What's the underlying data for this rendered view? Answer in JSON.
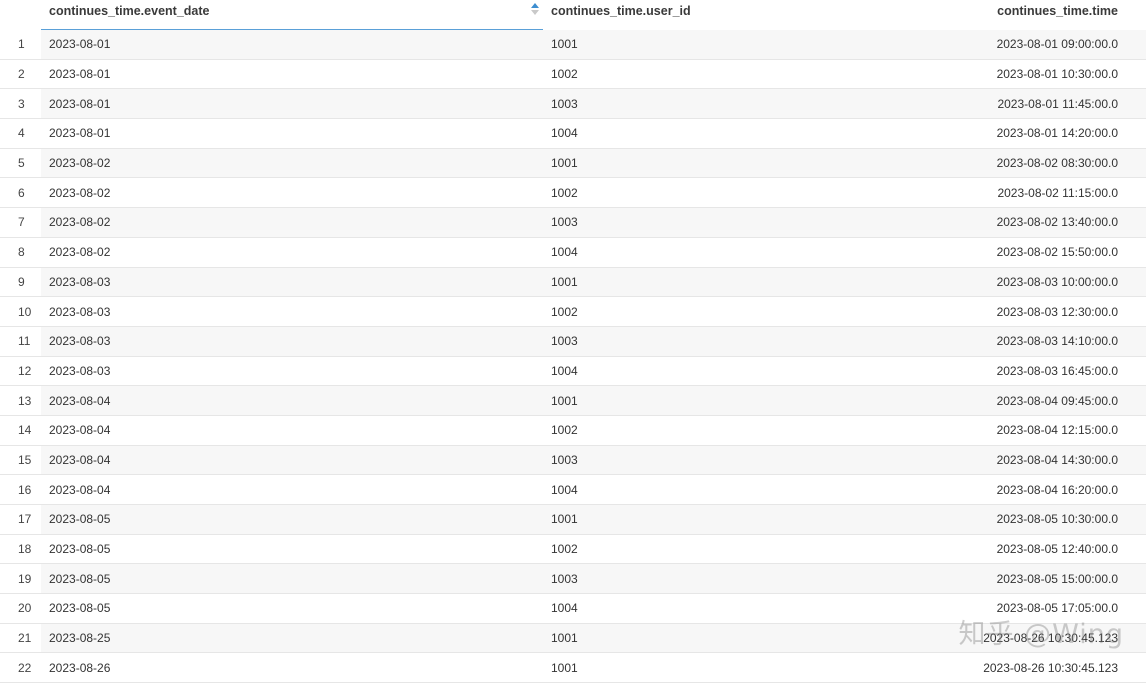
{
  "columns": [
    {
      "label": "continues_time.event_date",
      "sorted": "ascending"
    },
    {
      "label": "continues_time.user_id"
    },
    {
      "label": "continues_time.time"
    }
  ],
  "rows": [
    {
      "n": "1",
      "event_date": "2023-08-01",
      "user_id": "1001",
      "time": "2023-08-01 09:00:00.0"
    },
    {
      "n": "2",
      "event_date": "2023-08-01",
      "user_id": "1002",
      "time": "2023-08-01 10:30:00.0"
    },
    {
      "n": "3",
      "event_date": "2023-08-01",
      "user_id": "1003",
      "time": "2023-08-01 11:45:00.0"
    },
    {
      "n": "4",
      "event_date": "2023-08-01",
      "user_id": "1004",
      "time": "2023-08-01 14:20:00.0"
    },
    {
      "n": "5",
      "event_date": "2023-08-02",
      "user_id": "1001",
      "time": "2023-08-02 08:30:00.0"
    },
    {
      "n": "6",
      "event_date": "2023-08-02",
      "user_id": "1002",
      "time": "2023-08-02 11:15:00.0"
    },
    {
      "n": "7",
      "event_date": "2023-08-02",
      "user_id": "1003",
      "time": "2023-08-02 13:40:00.0"
    },
    {
      "n": "8",
      "event_date": "2023-08-02",
      "user_id": "1004",
      "time": "2023-08-02 15:50:00.0"
    },
    {
      "n": "9",
      "event_date": "2023-08-03",
      "user_id": "1001",
      "time": "2023-08-03 10:00:00.0"
    },
    {
      "n": "10",
      "event_date": "2023-08-03",
      "user_id": "1002",
      "time": "2023-08-03 12:30:00.0"
    },
    {
      "n": "11",
      "event_date": "2023-08-03",
      "user_id": "1003",
      "time": "2023-08-03 14:10:00.0"
    },
    {
      "n": "12",
      "event_date": "2023-08-03",
      "user_id": "1004",
      "time": "2023-08-03 16:45:00.0"
    },
    {
      "n": "13",
      "event_date": "2023-08-04",
      "user_id": "1001",
      "time": "2023-08-04 09:45:00.0"
    },
    {
      "n": "14",
      "event_date": "2023-08-04",
      "user_id": "1002",
      "time": "2023-08-04 12:15:00.0"
    },
    {
      "n": "15",
      "event_date": "2023-08-04",
      "user_id": "1003",
      "time": "2023-08-04 14:30:00.0"
    },
    {
      "n": "16",
      "event_date": "2023-08-04",
      "user_id": "1004",
      "time": "2023-08-04 16:20:00.0"
    },
    {
      "n": "17",
      "event_date": "2023-08-05",
      "user_id": "1001",
      "time": "2023-08-05 10:30:00.0"
    },
    {
      "n": "18",
      "event_date": "2023-08-05",
      "user_id": "1002",
      "time": "2023-08-05 12:40:00.0"
    },
    {
      "n": "19",
      "event_date": "2023-08-05",
      "user_id": "1003",
      "time": "2023-08-05 15:00:00.0"
    },
    {
      "n": "20",
      "event_date": "2023-08-05",
      "user_id": "1004",
      "time": "2023-08-05 17:05:00.0"
    },
    {
      "n": "21",
      "event_date": "2023-08-25",
      "user_id": "1001",
      "time": "2023-08-26 10:30:45.123"
    },
    {
      "n": "22",
      "event_date": "2023-08-26",
      "user_id": "1001",
      "time": "2023-08-26 10:30:45.123"
    }
  ],
  "watermark": "知乎 @Wing",
  "colors": {
    "sort_accent": "#3d8ed0",
    "header_underline": "#5aa0d8",
    "row_stripe": "#f7f7f7",
    "row_divider": "#e6e6e6"
  }
}
